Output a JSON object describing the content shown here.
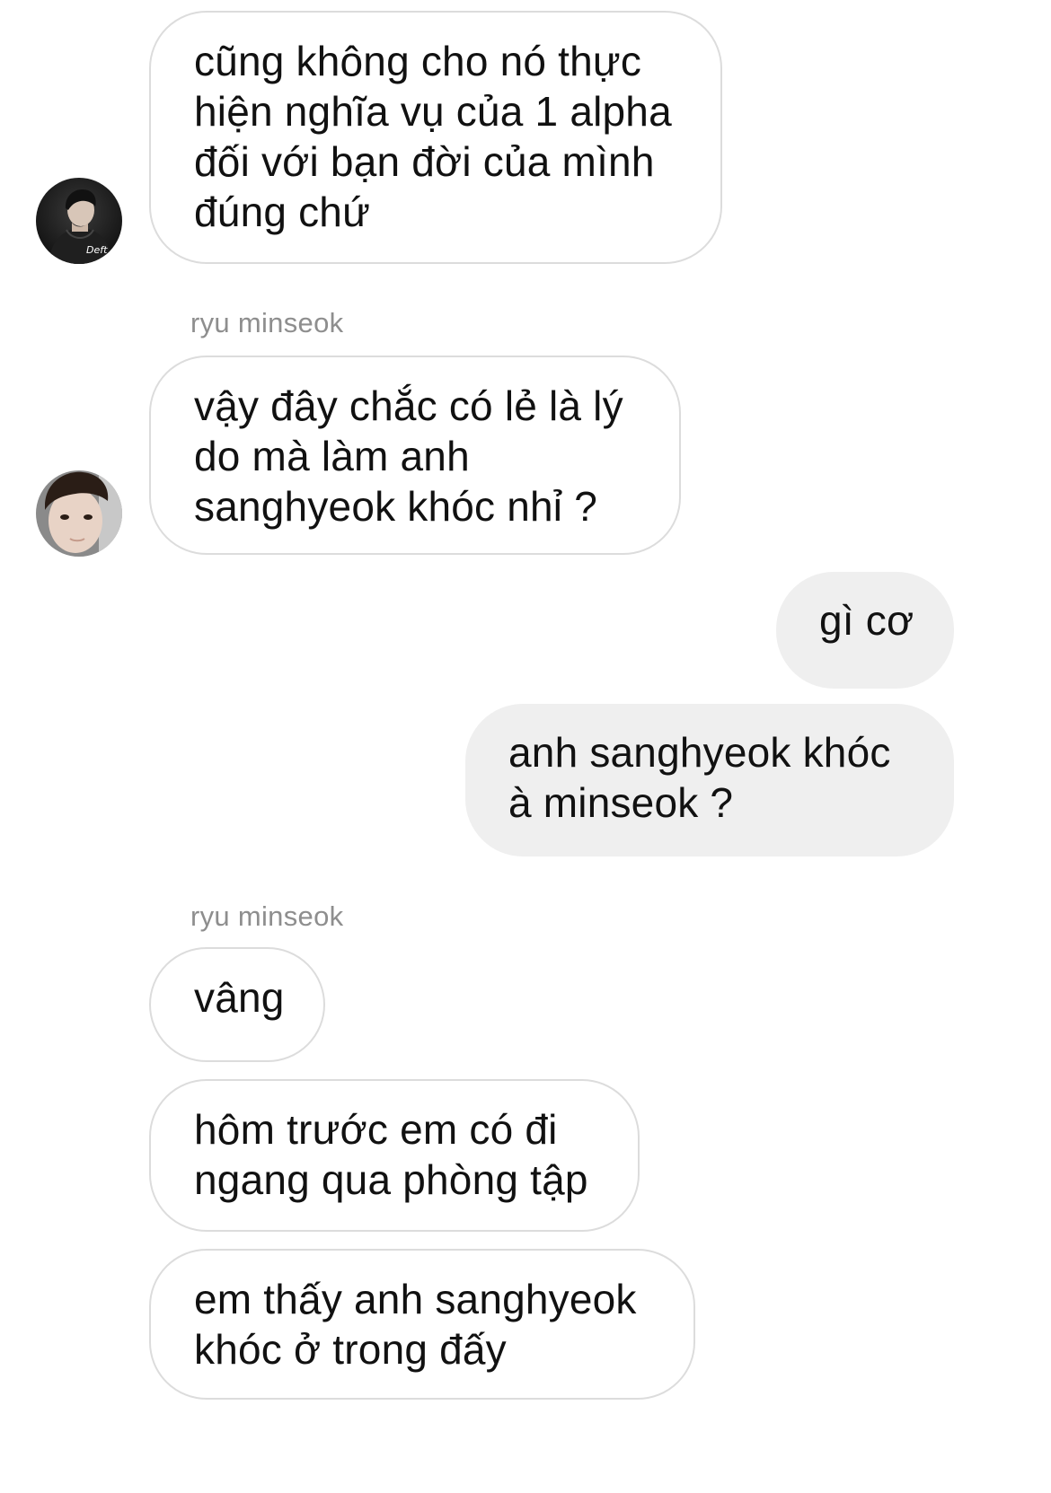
{
  "colors": {
    "incoming_bubble_bg": "#ffffff",
    "incoming_bubble_border": "#dcdcdc",
    "outgoing_bubble_bg": "#efefef",
    "sender_name": "#8e8e8e",
    "message_text": "#111111"
  },
  "messages": [
    {
      "direction": "incoming",
      "text": "cũng không cho nó thực\nhiện nghĩa vụ của 1 alpha\nđối với bạn đời của mình\nđúng chứ",
      "avatar": {
        "icon": "profile-photo-dark-jacket",
        "overlay_text": "Deft"
      }
    },
    {
      "direction": "incoming",
      "sender": "ryu minseok",
      "text": "vậy đây chắc có lẻ là lý\ndo mà làm anh\nsanghyeok khóc nhỉ ?",
      "avatar": {
        "icon": "profile-photo-face"
      }
    },
    {
      "direction": "outgoing",
      "text": "gì cơ"
    },
    {
      "direction": "outgoing",
      "text": "anh sanghyeok khóc\nà minseok ?"
    },
    {
      "direction": "incoming",
      "sender": "ryu minseok",
      "text": "vâng"
    },
    {
      "direction": "incoming",
      "text": "hôm trước em có đi\nngang qua phòng tập"
    },
    {
      "direction": "incoming",
      "text": "em thấy anh sanghyeok\nkhóc ở trong đấy"
    }
  ]
}
